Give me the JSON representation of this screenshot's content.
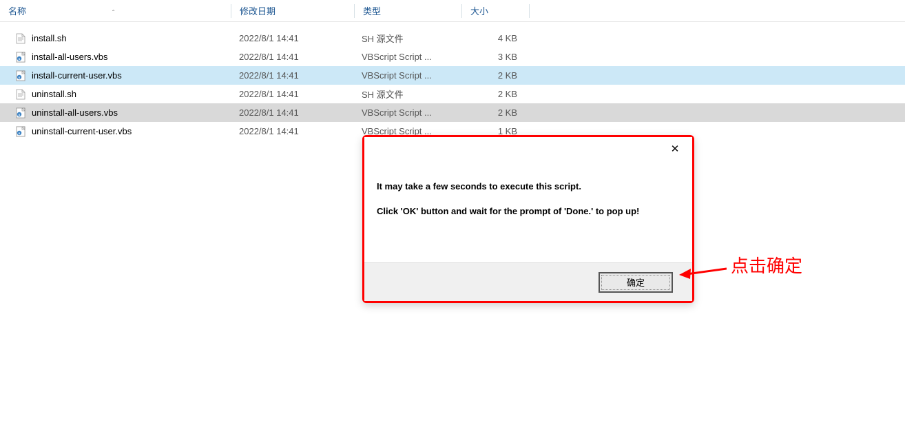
{
  "columns": {
    "name": "名称",
    "date": "修改日期",
    "type": "类型",
    "size": "大小"
  },
  "files": [
    {
      "name": "install.sh",
      "date": "2022/8/1 14:41",
      "type": "SH 源文件",
      "size": "4 KB",
      "icon": "sh",
      "state": ""
    },
    {
      "name": "install-all-users.vbs",
      "date": "2022/8/1 14:41",
      "type": "VBScript Script ...",
      "size": "3 KB",
      "icon": "vbs",
      "state": ""
    },
    {
      "name": "install-current-user.vbs",
      "date": "2022/8/1 14:41",
      "type": "VBScript Script ...",
      "size": "2 KB",
      "icon": "vbs",
      "state": "selected"
    },
    {
      "name": "uninstall.sh",
      "date": "2022/8/1 14:41",
      "type": "SH 源文件",
      "size": "2 KB",
      "icon": "sh",
      "state": ""
    },
    {
      "name": "uninstall-all-users.vbs",
      "date": "2022/8/1 14:41",
      "type": "VBScript Script ...",
      "size": "2 KB",
      "icon": "vbs",
      "state": "highlighted"
    },
    {
      "name": "uninstall-current-user.vbs",
      "date": "2022/8/1 14:41",
      "type": "VBScript Script ...",
      "size": "1 KB",
      "icon": "vbs",
      "state": ""
    }
  ],
  "dialog": {
    "line1": "It may take a few seconds to execute this script.",
    "line2": "Click 'OK' button and wait for the prompt of 'Done.' to pop up!",
    "ok_label": "确定"
  },
  "annotation": "点击确定"
}
